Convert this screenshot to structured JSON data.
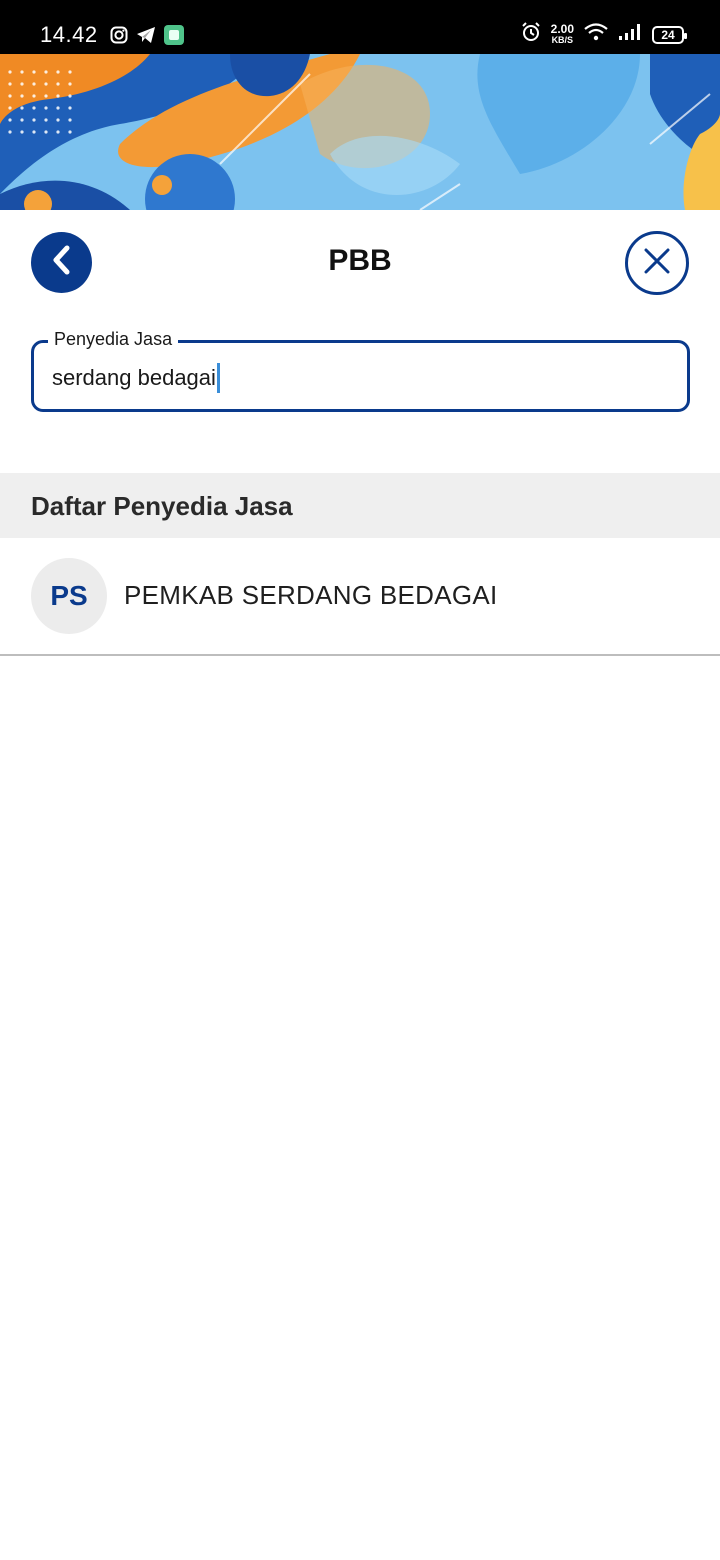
{
  "status_bar": {
    "time": "14.42",
    "net_speed_value": "2.00",
    "net_speed_unit": "KB/S",
    "battery_level": "24",
    "icons": [
      "instagram-icon",
      "telegram-icon",
      "app-icon",
      "alarm-icon",
      "wifi-icon",
      "signal-icon",
      "battery-icon"
    ]
  },
  "header": {
    "title": "PBB",
    "back_icon": "chevron-left-icon",
    "close_icon": "close-icon"
  },
  "search": {
    "label": "Penyedia Jasa",
    "value": "serdang bedagai"
  },
  "list": {
    "title": "Daftar Penyedia Jasa",
    "items": [
      {
        "initials": "PS",
        "name": "PEMKAB SERDANG BEDAGAI"
      }
    ]
  },
  "colors": {
    "primary": "#0a3a8c",
    "section_bg": "#efefef",
    "caret": "#3a8ed8"
  }
}
